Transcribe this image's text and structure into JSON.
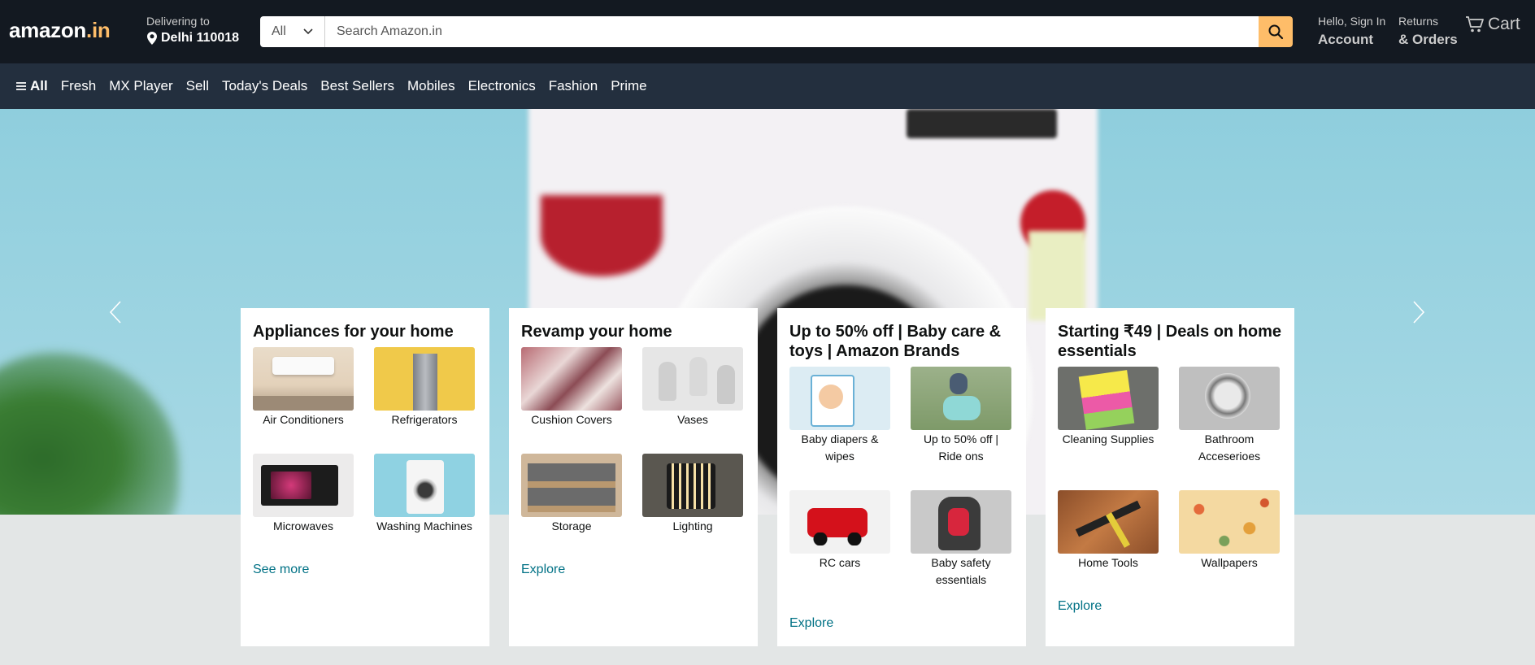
{
  "header": {
    "logo_main": "amazon",
    "logo_tld": ".in",
    "delivering_label": "Delivering to",
    "delivering_location": "Delhi 110018",
    "search": {
      "category": "All",
      "placeholder": "Search Amazon.in"
    },
    "account": {
      "line1": "Hello, Sign In",
      "line2": "Account"
    },
    "returns": {
      "line1": "Returns",
      "line2": "& Orders"
    },
    "cart_label": "Cart"
  },
  "subnav": {
    "all_label": "All",
    "links": [
      "Fresh",
      "MX Player",
      "Sell",
      "Today's Deals",
      "Best Sellers",
      "Mobiles",
      "Electronics",
      "Fashion",
      "Prime"
    ]
  },
  "cards": [
    {
      "title": "Appliances for your home",
      "items": [
        "Air Conditioners",
        "Refrigerators",
        "Microwaves",
        "Washing Machines"
      ],
      "link": "See more"
    },
    {
      "title": "Revamp your home",
      "items": [
        "Cushion Covers",
        "Vases",
        "Storage",
        "Lighting"
      ],
      "link": "Explore"
    },
    {
      "title": "Up to 50% off | Baby care & toys | Amazon Brands",
      "items": [
        "Baby diapers & wipes",
        "Up to 50% off | Ride ons",
        "RC cars",
        "Baby safety essentials"
      ],
      "link": "Explore"
    },
    {
      "title": "Starting ₹49 | Deals on home essentials",
      "items": [
        "Cleaning Supplies",
        "Bathroom Acceserioes",
        "Home Tools",
        "Wallpapers"
      ],
      "link": "Explore"
    }
  ],
  "colors": {
    "header_bg": "#131921",
    "subnav_bg": "#232f3e",
    "search_button": "#febd69",
    "link": "#007185",
    "page_bg": "#e3e6e6"
  },
  "icons": {
    "location": "location-pin-icon",
    "search": "magnifier-icon",
    "cart": "cart-icon",
    "menu": "hamburger-icon",
    "prev": "chevron-left-icon",
    "next": "chevron-right-icon"
  }
}
